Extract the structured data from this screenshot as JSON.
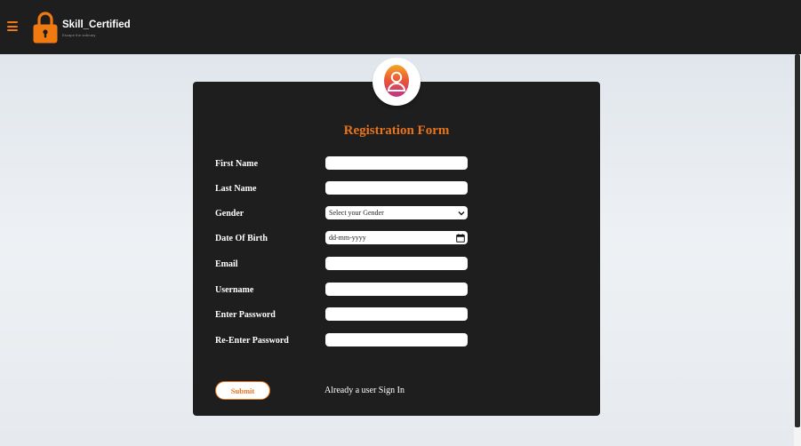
{
  "brand": {
    "name": "Skill_Certified",
    "tagline": "Escape the ordinary"
  },
  "nav": {
    "menu_icon": "hamburger-menu-icon",
    "logo_icon": "padlock-icon"
  },
  "colors": {
    "accent": "#e8731a",
    "navbar_bg": "#1e1e1e",
    "card_bg": "#1e1e1e",
    "page_bg": "#e6eaee"
  },
  "form": {
    "avatar_icon": "user-avatar-icon",
    "title": "Registration Form",
    "fields": {
      "first_name": {
        "label": "First Name",
        "value": "",
        "placeholder": ""
      },
      "last_name": {
        "label": "Last Name",
        "value": "",
        "placeholder": ""
      },
      "gender": {
        "label": "Gender",
        "selected": "Select your Gender"
      },
      "dob": {
        "label": "Date Of Birth",
        "placeholder": "dd-mm-yyyy"
      },
      "email": {
        "label": "Email",
        "value": "",
        "placeholder": ""
      },
      "username": {
        "label": "Username",
        "value": "",
        "placeholder": ""
      },
      "password": {
        "label": "Enter Password",
        "value": "",
        "placeholder": ""
      },
      "confirm_password": {
        "label": "Re-Enter Password",
        "value": "",
        "placeholder": ""
      }
    },
    "submit_label": "Submit",
    "signin_text": "Already a user Sign In"
  }
}
